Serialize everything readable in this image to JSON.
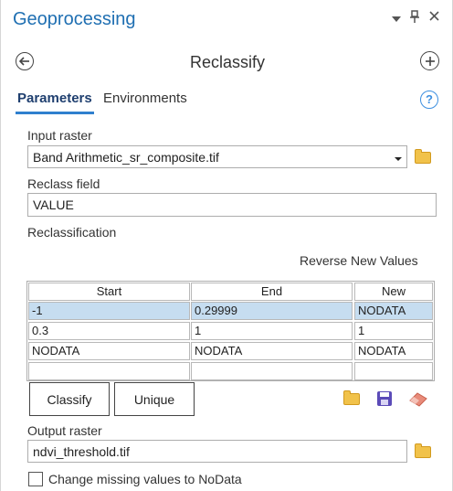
{
  "pane": {
    "title": "Geoprocessing"
  },
  "tool": {
    "title": "Reclassify"
  },
  "tabs": [
    {
      "label": "Parameters",
      "active": true
    },
    {
      "label": "Environments",
      "active": false
    }
  ],
  "input_raster": {
    "label": "Input raster",
    "value": "Band Arithmetic_sr_composite.tif"
  },
  "reclass_field": {
    "label": "Reclass field",
    "value": "VALUE"
  },
  "reclassification": {
    "label": "Reclassification",
    "reverse_label": "Reverse New Values",
    "columns": [
      "Start",
      "End",
      "New"
    ],
    "rows": [
      [
        "-1",
        "0.29999",
        "NODATA"
      ],
      [
        "0.3",
        "1",
        "1"
      ],
      [
        "NODATA",
        "NODATA",
        "NODATA"
      ],
      [
        "",
        "",
        ""
      ]
    ],
    "classify_label": "Classify",
    "unique_label": "Unique"
  },
  "output_raster": {
    "label": "Output raster",
    "value": "ndvi_threshold.tif"
  },
  "missing_values": {
    "label": "Change missing values to NoData",
    "checked": false
  },
  "colors": {
    "accent": "#2f7fce",
    "title": "#1f6fb2",
    "selected_row": "#c6ddf0"
  },
  "icons": [
    "back-arrow-icon",
    "add-icon",
    "help-icon",
    "folder-icon",
    "save-icon",
    "eraser-icon",
    "pin-icon",
    "close-icon"
  ]
}
